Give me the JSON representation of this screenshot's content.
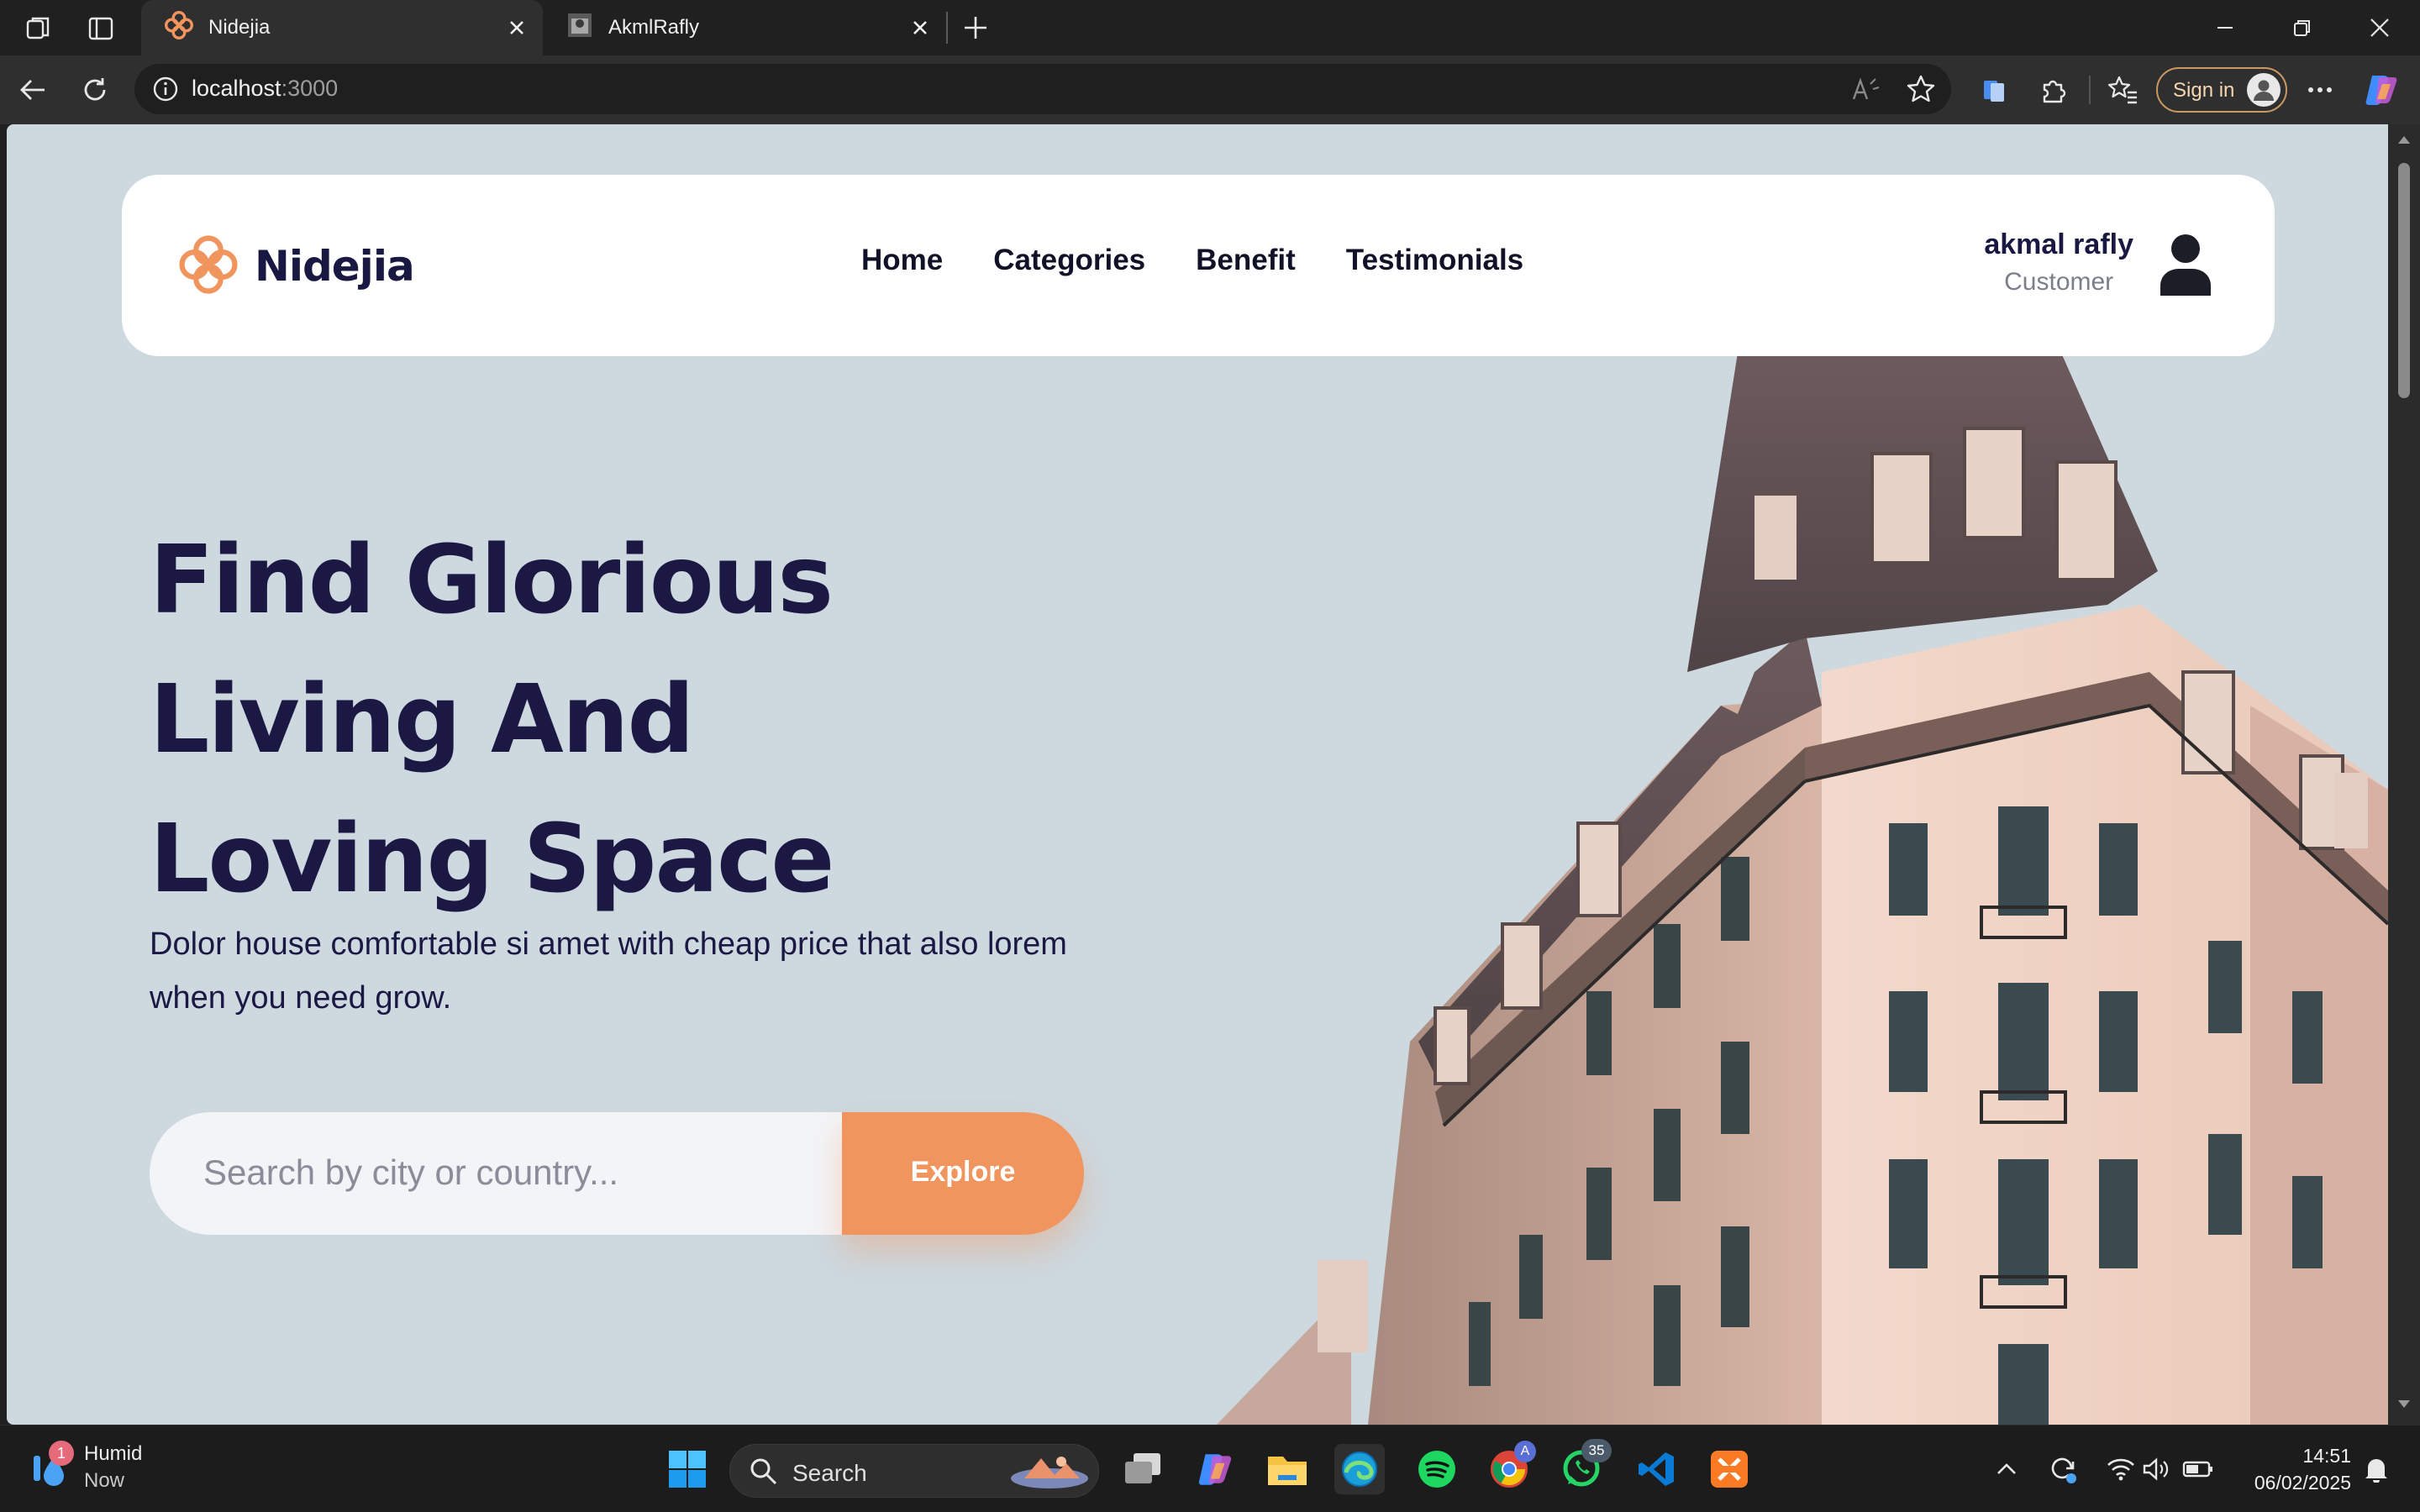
{
  "browser": {
    "tabs": [
      {
        "title": "Nidejia",
        "active": true
      },
      {
        "title": "AkmlRafly",
        "active": false
      }
    ],
    "url_host": "localhost",
    "url_port": ":3000",
    "signin_label": "Sign in"
  },
  "navbar": {
    "brand": "Nidejia",
    "links": [
      "Home",
      "Categories",
      "Benefit",
      "Testimonials"
    ],
    "user_name": "akmal rafly",
    "user_role": "Customer"
  },
  "hero": {
    "title_lines": [
      "Find Glorious",
      "Living And",
      "Loving Space"
    ],
    "subtitle": "Dolor house comfortable si amet with cheap price that also lorem when you need grow.",
    "search_placeholder": "Search by city or country...",
    "explore_label": "Explore"
  },
  "taskbar": {
    "weather_title": "Humid",
    "weather_time": "Now",
    "weather_badge": "1",
    "search_label": "Search",
    "whatsapp_badge": "35",
    "chrome_badge": "A",
    "time": "14:51",
    "date": "06/02/2025"
  },
  "colors": {
    "accent": "#f0955e",
    "hero_bg": "#cdd8df",
    "heading": "#1b1844"
  }
}
